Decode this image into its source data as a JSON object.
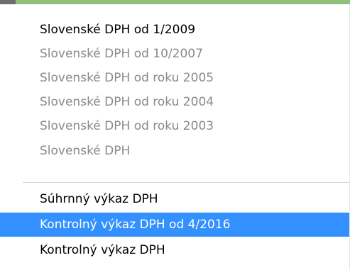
{
  "menu": {
    "items": [
      {
        "label": "Slovenské DPH od 1/2009",
        "enabled": true
      },
      {
        "label": "Slovenské DPH od 10/2007",
        "enabled": false
      },
      {
        "label": "Slovenské DPH od roku 2005",
        "enabled": false
      },
      {
        "label": "Slovenské DPH od roku 2004",
        "enabled": false
      },
      {
        "label": "Slovenské DPH od roku 2003",
        "enabled": false
      },
      {
        "label": "Slovenské DPH",
        "enabled": false
      },
      {
        "label": "Súhrnný výkaz DPH",
        "enabled": true
      },
      {
        "label": "Kontrolný výkaz DPH od 4/2016",
        "enabled": true,
        "highlighted": true
      },
      {
        "label": "Kontrolný výkaz DPH",
        "enabled": true
      }
    ]
  },
  "colors": {
    "highlight": "#3390ff",
    "disabled_text": "#8a8a8a",
    "top_strip": "#8fbf7a"
  }
}
